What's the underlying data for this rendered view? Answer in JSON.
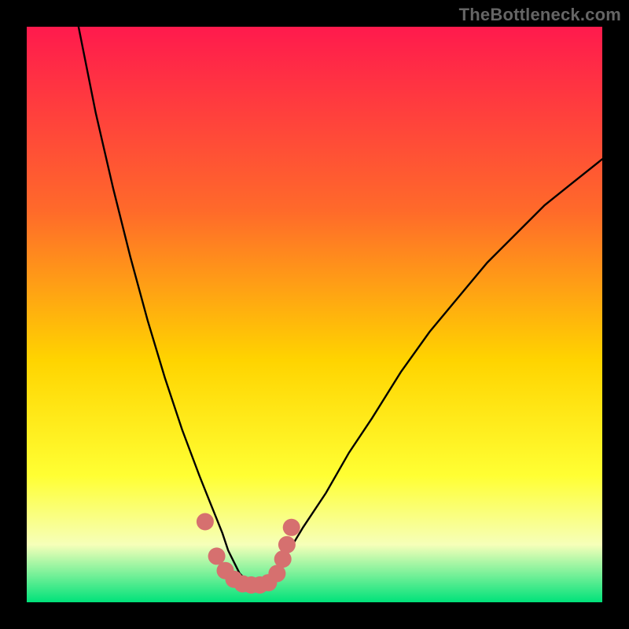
{
  "attribution": "TheBottleneck.com",
  "colors": {
    "frame": "#000000",
    "gradient_top": "#ff1a4d",
    "gradient_mid1": "#ff6a2a",
    "gradient_mid2": "#ffd400",
    "gradient_mid3": "#ffff33",
    "gradient_mid4": "#f6ffb9",
    "gradient_bottom": "#00e27a",
    "curve": "#000000",
    "marker": "#d6706f"
  },
  "chart_data": {
    "type": "line",
    "title": "",
    "xlabel": "",
    "ylabel": "",
    "xlim": [
      0,
      100
    ],
    "ylim": [
      0,
      100
    ],
    "series": [
      {
        "name": "bottleneck-curve",
        "x": [
          9,
          12,
          15,
          18,
          21,
          24,
          27,
          30,
          32,
          34,
          35,
          36,
          37,
          38,
          39,
          40,
          41,
          42,
          43,
          45,
          48,
          52,
          56,
          60,
          65,
          70,
          75,
          80,
          85,
          90,
          95,
          100
        ],
        "values": [
          100,
          85,
          72,
          60,
          49,
          39,
          30,
          22,
          17,
          12,
          9,
          7,
          5,
          4,
          3,
          3,
          3,
          4,
          5,
          8,
          13,
          19,
          26,
          32,
          40,
          47,
          53,
          59,
          64,
          69,
          73,
          77
        ]
      }
    ],
    "markers": {
      "name": "highlighted-points",
      "x": [
        31,
        33,
        34.5,
        36,
        37.5,
        39,
        40.5,
        42,
        43.5,
        44.5,
        45.2,
        46
      ],
      "values": [
        14,
        8,
        5.5,
        4,
        3.2,
        3,
        3,
        3.4,
        5,
        7.5,
        10,
        13
      ]
    }
  }
}
